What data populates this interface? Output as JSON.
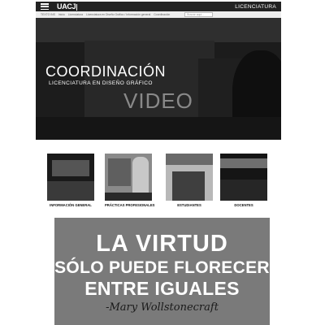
{
  "header": {
    "logo": "UACJ",
    "right_label": "LICENCIATURA"
  },
  "breadcrumb": {
    "items": [
      "TEXTO INS",
      "Inicio",
      "Licenciatura",
      "Licenciatura en Diseño Gráfico / Información general",
      "Coordinación"
    ],
    "search_placeholder": "Buscar aquí..."
  },
  "hero": {
    "title": "COORDINACIÓN",
    "subtitle": "LICENCIATURA EN DISEÑO GRÁFICO",
    "video_label": "VIDEO"
  },
  "tiles": [
    {
      "label": "INFORMACIÓN GENERAL"
    },
    {
      "label": "PRÁCTICAS PROFESIONALES"
    },
    {
      "label": "ESTUDIANTES"
    },
    {
      "label": "DOCENTES"
    }
  ],
  "banner": {
    "line1": "LA VIRTUD",
    "line2": "SÓLO PUEDE FLORECER",
    "line3": "ENTRE IGUALES",
    "author": "-Mary Wollstonecraft"
  },
  "colors": {
    "topbar": "#222222",
    "hero_bg": "#1c1c1c",
    "banner_bg": "#7a7a7a"
  }
}
